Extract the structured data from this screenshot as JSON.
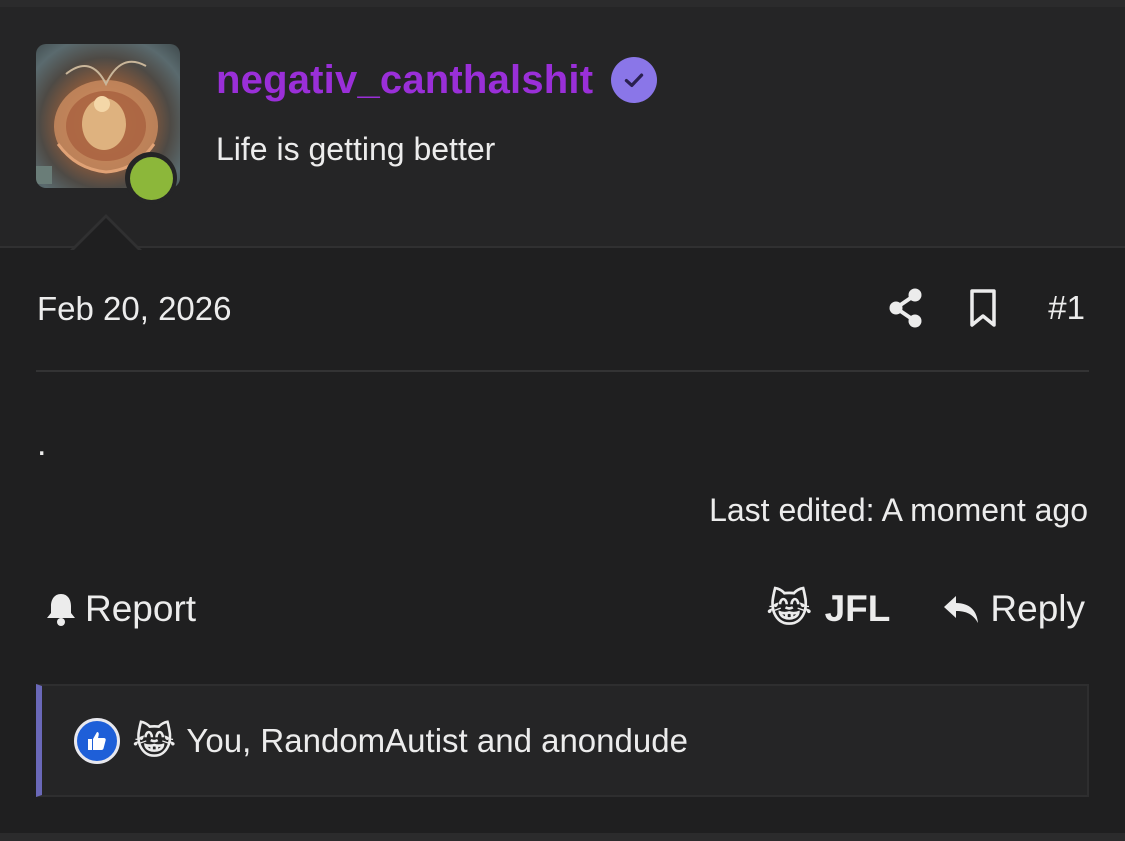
{
  "user": {
    "username": "negativ_canthalshit",
    "title": "Life is getting better",
    "online": true,
    "verified": true,
    "username_color": "#9a2fd8",
    "verified_color": "#8a76e8",
    "online_color": "#8cb73a"
  },
  "post": {
    "date": "Feb 20, 2026",
    "number": "#1",
    "body": ".",
    "last_edited": "Last edited: A moment ago"
  },
  "actions": {
    "report_label": "Report",
    "jfl_label": "JFL",
    "jfl_emoji": "😹",
    "reply_label": "Reply"
  },
  "reactions": {
    "emoji": "😹",
    "users_text": "You, RandomAutist and anondude",
    "accent": "#6a68b8"
  },
  "icons": {
    "share": "share-icon",
    "bookmark": "bookmark-icon",
    "bell": "bell-icon",
    "reply": "reply-icon",
    "like": "thumbs-up-icon",
    "verified": "verified-check-icon"
  }
}
